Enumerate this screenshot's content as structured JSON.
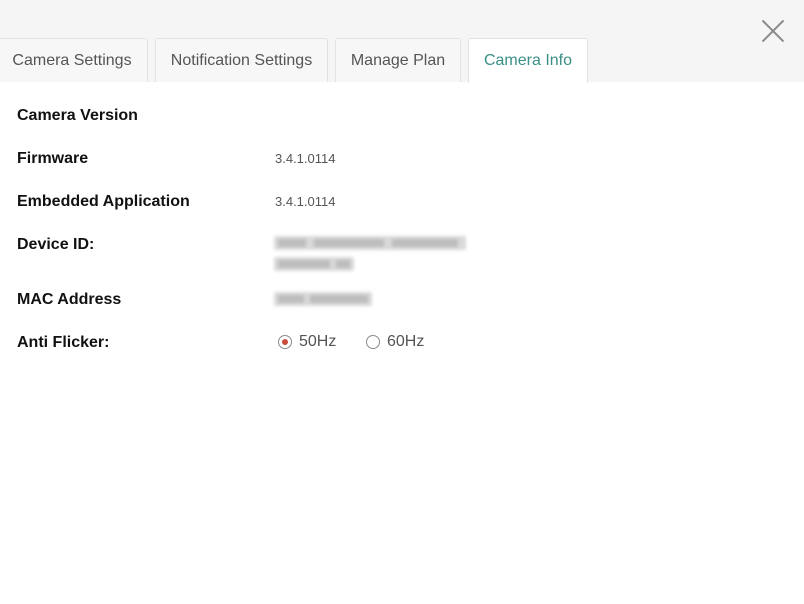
{
  "close_icon": "close-icon",
  "tabs": [
    {
      "label": "Camera Settings",
      "active": false
    },
    {
      "label": "Notification Settings",
      "active": false
    },
    {
      "label": "Manage Plan",
      "active": false
    },
    {
      "label": "Camera Info",
      "active": true
    }
  ],
  "colors": {
    "active_tab_text": "#3a8f86",
    "radio_selected": "#c94b3b",
    "header_bg": "#f5f5f5"
  },
  "info": {
    "section_title": "Camera Version",
    "firmware_label": "Firmware",
    "firmware_value": "3.4.1.0114",
    "embedded_label": "Embedded Application",
    "embedded_value": "3.4.1.0114",
    "device_id_label": "Device ID:",
    "mac_label": "MAC Address",
    "anti_flicker_label": "Anti Flicker:"
  },
  "anti_flicker": {
    "options": [
      "50Hz",
      "60Hz"
    ],
    "selected": "50Hz"
  }
}
